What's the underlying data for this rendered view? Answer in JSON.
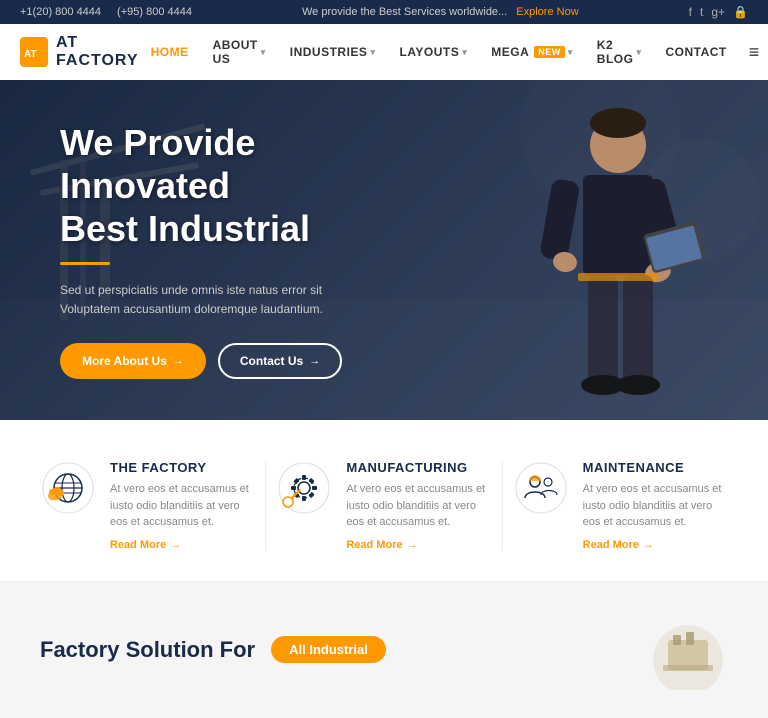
{
  "topbar": {
    "phone1": "+1(20) 800 4444",
    "phone2": "(+95) 800 4444",
    "tagline": "We provide the Best Services worldwide...",
    "explore": "Explore Now",
    "social": [
      "f",
      "t",
      "g+",
      "🔒"
    ]
  },
  "header": {
    "logo_text": "AT FACTORY",
    "logo_letter": "AT",
    "nav": [
      {
        "label": "HOME",
        "active": true,
        "hasArrow": false
      },
      {
        "label": "ABOUT US",
        "active": false,
        "hasArrow": true
      },
      {
        "label": "INDUSTRIES",
        "active": false,
        "hasArrow": true
      },
      {
        "label": "LAYOUTS",
        "active": false,
        "hasArrow": true
      },
      {
        "label": "MEGA",
        "active": false,
        "hasArrow": true,
        "badge": "NEW"
      },
      {
        "label": "K2 BLOG",
        "active": false,
        "hasArrow": true
      },
      {
        "label": "CONTACT",
        "active": false,
        "hasArrow": false
      }
    ]
  },
  "hero": {
    "title_line1": "We Provide Innovated",
    "title_line2": "Best Industrial",
    "description": "Sed ut perspiciatis unde omnis iste natus error sit Voluptatem accusantium doloremque laudantium.",
    "btn1_label": "More About Us",
    "btn2_label": "Contact Us",
    "arrow": "→"
  },
  "services": [
    {
      "title": "THE FACTORY",
      "desc": "At vero eos et accusamus et iusto odio blanditiis at vero eos et accusamus et.",
      "link": "Read More",
      "icon": "factory"
    },
    {
      "title": "MANUFACTURING",
      "desc": "At vero eos et accusamus et iusto odio blanditiis at vero eos et accusamus et.",
      "link": "Read More",
      "icon": "gear"
    },
    {
      "title": "MAINTENANCE",
      "desc": "At vero eos et accusamus et iusto odio blanditiis at vero eos et accusamus et.",
      "link": "Read More",
      "icon": "maintenance"
    }
  ],
  "teaser": {
    "title": "Factory Solution For",
    "badge": "All Industrial"
  }
}
